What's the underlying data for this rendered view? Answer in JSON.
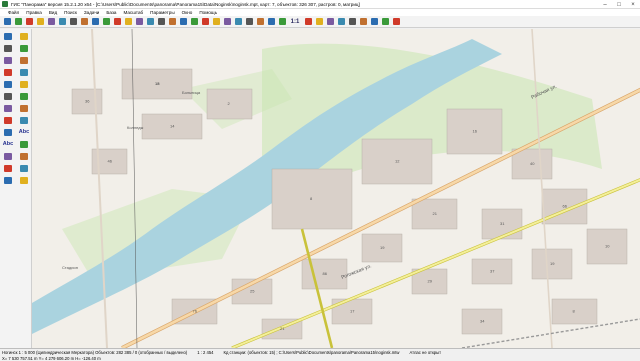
{
  "window": {
    "title": "ГИС \"Панорама\" версия 15.2.1.20 x64 - [C:\\Users\\Public\\Documents\\panorama\\Panorama15\\Data\\Noginsk\\noginsk.mpt, карт: 7, объектов: 326 307, растров: 0, матриц]"
  },
  "menu": [
    {
      "label": "Файл"
    },
    {
      "label": "Правка"
    },
    {
      "label": "Вид"
    },
    {
      "label": "Поиск"
    },
    {
      "label": "Задачи"
    },
    {
      "label": "База"
    },
    {
      "label": "Масштаб"
    },
    {
      "label": "Параметры"
    },
    {
      "label": "Окно"
    },
    {
      "label": "Помощь"
    }
  ],
  "toolbar": {
    "scale_button": "1:1",
    "icons": [
      "new-map-icon",
      "open-icon",
      "save-icon",
      "print-icon",
      "select-icon",
      "zoom-in-icon",
      "zoom-out-icon",
      "layers-icon",
      "binoculars-icon",
      "binoculars-icon",
      "search-icon",
      "info-icon",
      "legend-icon",
      "measure-icon",
      "area-icon",
      "grid-icon",
      "colors-icon",
      "pie-icon",
      "map-icon",
      "3d-icon",
      "cut-icon",
      "globe-icon",
      "pan-icon",
      "zoom-icon",
      "magnifier-icon",
      "scale-icon",
      "overview-icon",
      "check-icon",
      "window-icon",
      "table-icon",
      "layers-icon",
      "export-icon",
      "settings-icon",
      "chart-icon",
      "help-icon"
    ],
    "colors": {
      "accent": "#2b6cb0",
      "green": "#3a9a3a",
      "red": "#d03a2a",
      "yellow": "#e0b020"
    }
  },
  "left_tools": {
    "abc_labels": [
      "Abc",
      "Abc"
    ],
    "icons": [
      "pencil-icon",
      "pencil-icon",
      "line-icon",
      "select-icon",
      "polygon-icon",
      "vertex-icon",
      "move-icon",
      "rotate-icon",
      "cut-icon",
      "delete-icon",
      "check-icon",
      "copy-icon",
      "text-icon",
      "align-icon",
      "sign-icon",
      "symbol-icon",
      "frame-icon",
      "abc-icon",
      "abc-icon",
      "connect-icon",
      "split-icon",
      "hatch-icon",
      "gradient-icon",
      "palette-icon",
      "fill-icon",
      "settings-icon"
    ]
  },
  "map": {
    "street_labels": [
      {
        "text": "Рабочая ул."
      },
      {
        "text": "Рогожская ул."
      }
    ],
    "area_labels": [
      {
        "text": "Колледж"
      },
      {
        "text": "Больница"
      },
      {
        "text": "Стадион"
      }
    ],
    "house_numbers": [
      "15",
      "14",
      "2",
      "8",
      "12",
      "16",
      "40",
      "66",
      "31",
      "21",
      "19",
      "86",
      "25",
      "76",
      "29",
      "37",
      "19",
      "10",
      "21",
      "17",
      "34",
      "8",
      "36",
      "46",
      "18"
    ],
    "colors": {
      "background": "#f2efe9",
      "river": "#aad3df",
      "park": "#c8e6b0",
      "road_primary": "#f0c674",
      "road_secondary": "#fefefe",
      "building": "#d9d0c9",
      "border": "#b0a8a0",
      "railway": "#999999"
    }
  },
  "status": {
    "row1": [
      {
        "text": "Нoгинск 1 : 5 000 (Цилиндрическая Меркатора) Объектов: 282 385 / 0 (отобранных / выделено)"
      },
      {
        "text": "1 : 2 454"
      },
      {
        "text": "Кд станции: (объектов: 15) ; C:\\Users\\Public\\Documents\\panorama\\Panorama15\\noginsk.mtw"
      },
      {
        "text": "Атлас не открыт"
      }
    ],
    "row2": [
      {
        "text": "X= 7 530 757.51 m   Y= 4 279 606.20 m   H= -126.40 m"
      }
    ]
  }
}
